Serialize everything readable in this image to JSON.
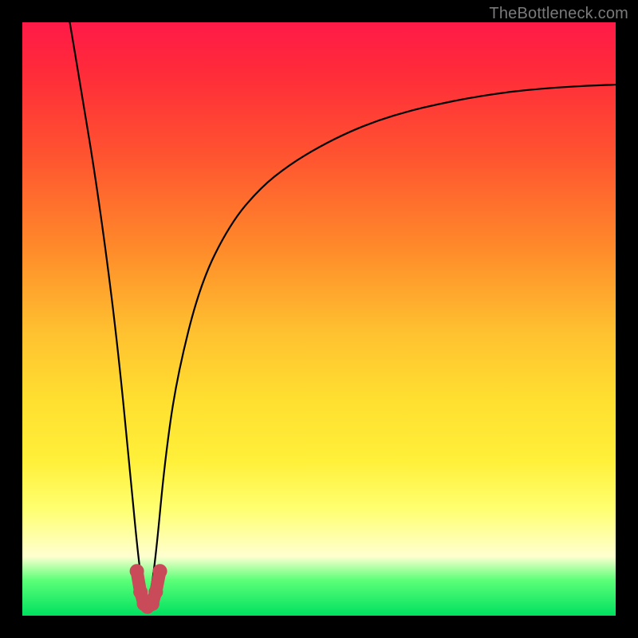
{
  "watermark": "TheBottleneck.com",
  "chart_data": {
    "type": "line",
    "title": "",
    "xlabel": "",
    "ylabel": "",
    "xlim": [
      0,
      100
    ],
    "ylim": [
      0,
      100
    ],
    "series": [
      {
        "name": "curve",
        "color": "#000000",
        "x": [
          8,
          10,
          12,
          14,
          16,
          18,
          19.5,
          20.5,
          21.5,
          22.5,
          24,
          26,
          30,
          35,
          40,
          45,
          50,
          55,
          60,
          65,
          70,
          75,
          80,
          85,
          90,
          95,
          100
        ],
        "y": [
          100,
          88,
          76,
          62,
          46,
          26,
          10,
          3,
          3,
          10,
          26,
          40,
          56,
          66,
          72,
          76,
          79,
          81.5,
          83.5,
          85,
          86.2,
          87.2,
          88,
          88.6,
          89,
          89.3,
          89.5
        ]
      },
      {
        "name": "bottom-marker",
        "color": "#c94a58",
        "x": [
          19.3,
          19.9,
          20.5,
          21.1,
          21.9,
          22.5,
          23.2
        ],
        "y": [
          7.5,
          4.0,
          2.0,
          1.5,
          2.0,
          4.0,
          7.5
        ]
      }
    ],
    "gradient_stops": [
      {
        "pos": 0,
        "color": "#ff1a48"
      },
      {
        "pos": 22,
        "color": "#ff5230"
      },
      {
        "pos": 52,
        "color": "#ffc030"
      },
      {
        "pos": 82,
        "color": "#ffff70"
      },
      {
        "pos": 94,
        "color": "#5cff78"
      },
      {
        "pos": 100,
        "color": "#00e060"
      }
    ]
  }
}
